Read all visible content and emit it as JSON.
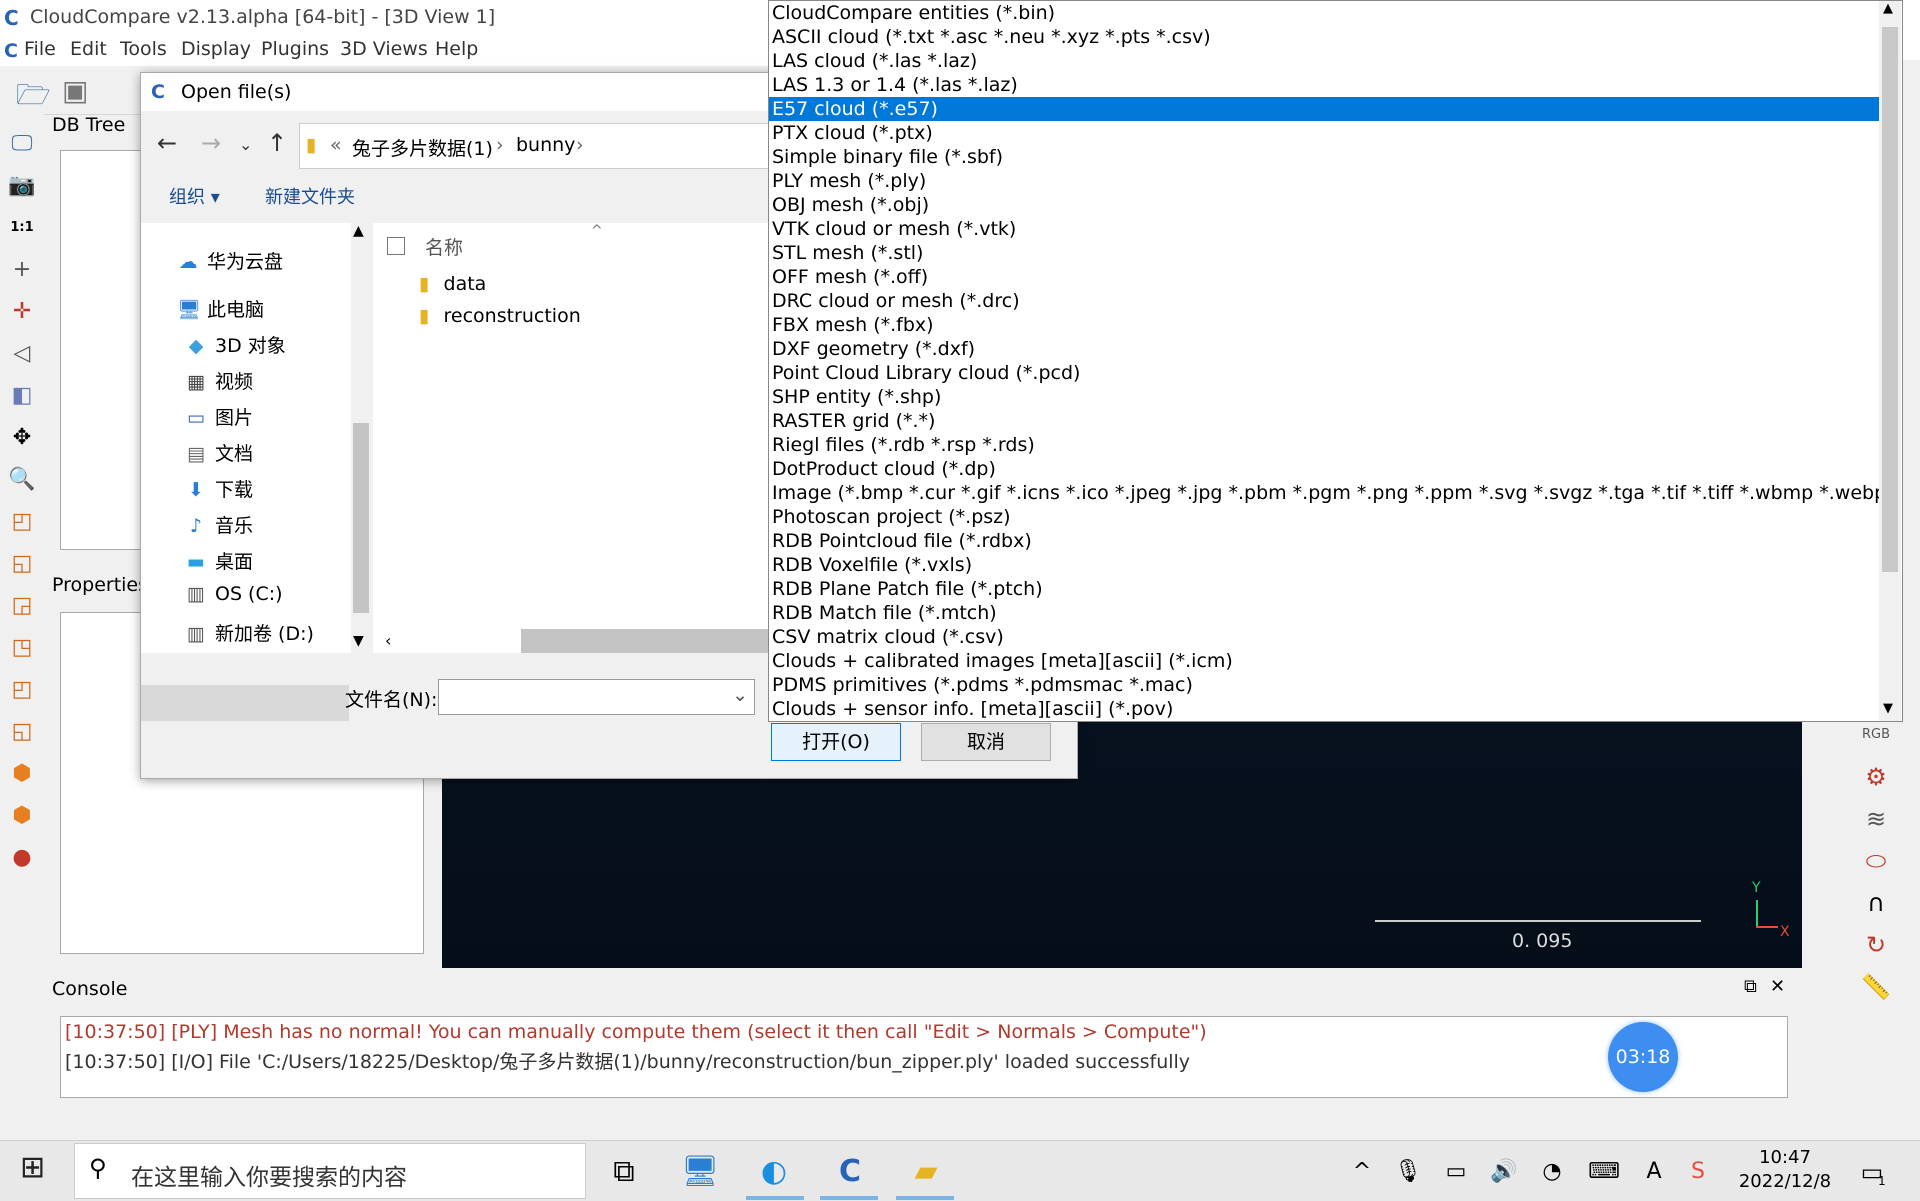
{
  "window": {
    "title": "CloudCompare v2.13.alpha [64-bit] - [3D View 1]"
  },
  "menu": [
    "File",
    "Edit",
    "Tools",
    "Display",
    "Plugins",
    "3D Views",
    "Help"
  ],
  "panels": {
    "db_tree": "DB Tree",
    "properties": "Properties",
    "console": "Console"
  },
  "view3d": {
    "scale_value": "0. 095",
    "axis_y": "Y",
    "axis_x": "X"
  },
  "console_lines": [
    "[10:37:50] [PLY] Mesh has no normal! You can manually compute them (select it then call \"Edit > Normals > Compute\")",
    "[10:37:50] [I/O] File 'C:/Users/18225/Desktop/兔子多片数据(1)/bunny/reconstruction/bun_zipper.ply' loaded successfully"
  ],
  "timer": "03:18",
  "dialog": {
    "title": "Open file(s)",
    "breadcrumb": [
      "«",
      "兔子多片数据(1)",
      "›",
      "bunny",
      "›"
    ],
    "organize": "组织 ▾",
    "new_folder": "新建文件夹",
    "column_name": "名称",
    "nav_items": [
      "华为云盘",
      "此电脑",
      "3D 对象",
      "视频",
      "图片",
      "文档",
      "下载",
      "音乐",
      "桌面",
      "OS (C:)",
      "新加卷 (D:)"
    ],
    "folders": [
      "data",
      "reconstruction"
    ],
    "filename_label": "文件名(N):",
    "filename_value": "",
    "open_button": "打开(O)",
    "cancel_button": "取消"
  },
  "file_types": [
    "CloudCompare entities (*.bin)",
    "ASCII cloud (*.txt *.asc *.neu *.xyz *.pts *.csv)",
    "LAS cloud (*.las *.laz)",
    "LAS 1.3 or 1.4 (*.las *.laz)",
    "E57 cloud (*.e57)",
    "PTX cloud (*.ptx)",
    "Simple binary file (*.sbf)",
    "PLY mesh (*.ply)",
    "OBJ mesh (*.obj)",
    "VTK cloud or mesh (*.vtk)",
    "STL mesh (*.stl)",
    "OFF mesh (*.off)",
    "DRC cloud or mesh (*.drc)",
    "FBX mesh (*.fbx)",
    "DXF geometry (*.dxf)",
    "Point Cloud Library cloud (*.pcd)",
    "SHP entity (*.shp)",
    "RASTER grid (*.*)",
    "Riegl files (*.rdb *.rsp *.rds)",
    "DotProduct cloud (*.dp)",
    "Image (*.bmp *.cur *.gif *.icns *.ico *.jpeg *.jpg *.pbm *.pgm *.png *.ppm *.svg *.svgz *.tga *.tif *.tiff *.wbmp *.webp *.xbm *.xpm)",
    "Photoscan project (*.psz)",
    "RDB Pointcloud file (*.rdbx)",
    "RDB Voxelfile (*.vxls)",
    "RDB Plane Patch file (*.ptch)",
    "RDB Match file (*.mtch)",
    "CSV matrix cloud (*.csv)",
    "Clouds + calibrated images [meta][ascii] (*.icm)",
    "PDMS primitives (*.pdms *.pdmsmac *.mac)",
    "Clouds + sensor info. [meta][ascii] (*.pov)"
  ],
  "selected_file_type_index": 4,
  "taskbar": {
    "search_placeholder": "在这里输入你要搜索的内容",
    "time": "10:47",
    "date": "2022/12/8",
    "notification_count": "1"
  },
  "colors": {
    "selection": "#0078d7",
    "view_bg": "#081626"
  }
}
